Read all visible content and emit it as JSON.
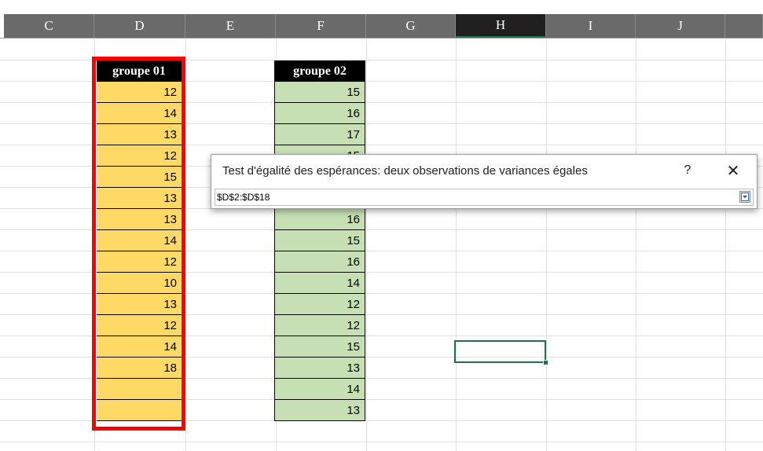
{
  "columns": [
    {
      "letter": "C",
      "active": false
    },
    {
      "letter": "D",
      "active": false
    },
    {
      "letter": "E",
      "active": false
    },
    {
      "letter": "F",
      "active": false
    },
    {
      "letter": "G",
      "active": false
    },
    {
      "letter": "H",
      "active": true
    },
    {
      "letter": "I",
      "active": false
    },
    {
      "letter": "J",
      "active": false
    }
  ],
  "group1": {
    "header": "groupe 01",
    "values": [
      "12",
      "14",
      "13",
      "12",
      "15",
      "13",
      "13",
      "14",
      "12",
      "10",
      "13",
      "12",
      "14",
      "18",
      "",
      ""
    ],
    "fill_color": "#ffd966",
    "highlight_color": "#ff0000"
  },
  "group2": {
    "header": "groupe 02",
    "values": [
      "15",
      "16",
      "17",
      "15",
      "",
      "",
      "16",
      "15",
      "16",
      "14",
      "12",
      "12",
      "15",
      "13",
      "14",
      "13"
    ],
    "fill_color": "#c6e0b4"
  },
  "dialog": {
    "title": "Test d'égalité des espérances: deux observations de variances égales",
    "help_label": "?",
    "close_label": "✕",
    "range_value": "$D$2:$D$18"
  },
  "selection": {
    "cell": "H15",
    "color": "#217346"
  }
}
